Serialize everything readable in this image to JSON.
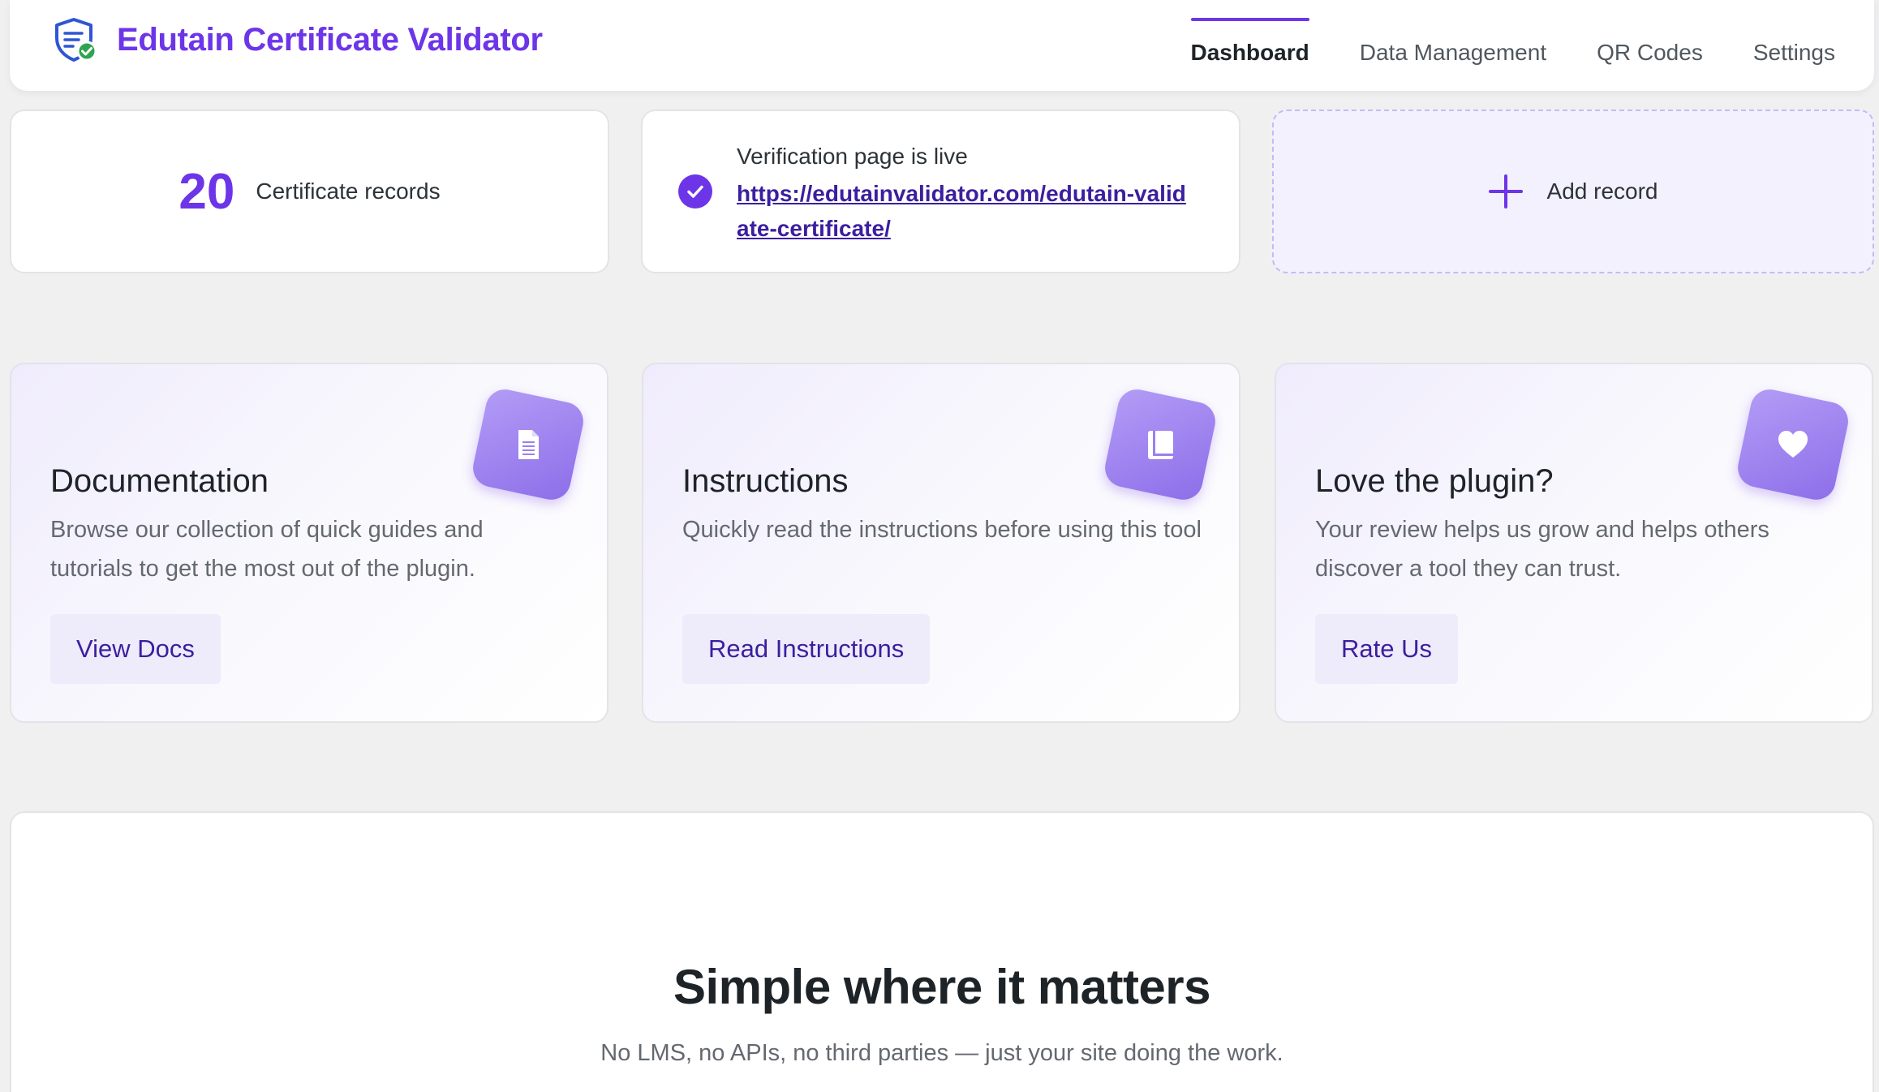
{
  "header": {
    "app_title": "Edutain Certificate Validator",
    "logo_icon": "shield-check-icon",
    "tabs": [
      {
        "label": "Dashboard",
        "active": true
      },
      {
        "label": "Data Management",
        "active": false
      },
      {
        "label": "QR Codes",
        "active": false
      },
      {
        "label": "Settings",
        "active": false
      }
    ]
  },
  "stats": {
    "records_count": "20",
    "records_label": "Certificate records",
    "live_title": "Verification page is live",
    "live_url": "https://edutainvalidator.com/edutain-validate-certificate/",
    "add_label": "Add record"
  },
  "cards": [
    {
      "title": "Documentation",
      "text": "Browse our collection of quick guides and tutorials to get the most out of the plugin.",
      "button": "View Docs",
      "icon": "document-icon"
    },
    {
      "title": "Instructions",
      "text": "Quickly read the instructions before using this tool",
      "button": "Read Instructions",
      "icon": "book-icon"
    },
    {
      "title": "Love the plugin?",
      "text": "Your review helps us grow and helps others discover a tool they can trust.",
      "button": "Rate Us",
      "icon": "heart-icon"
    }
  ],
  "bottom": {
    "heading": "Simple where it matters",
    "subtext": "No LMS, no APIs, no third parties — just your site doing the work."
  },
  "colors": {
    "accent": "#6d35e8",
    "link": "#3b1f9e",
    "background": "#f0f0f1",
    "success": "#2ea44f"
  }
}
